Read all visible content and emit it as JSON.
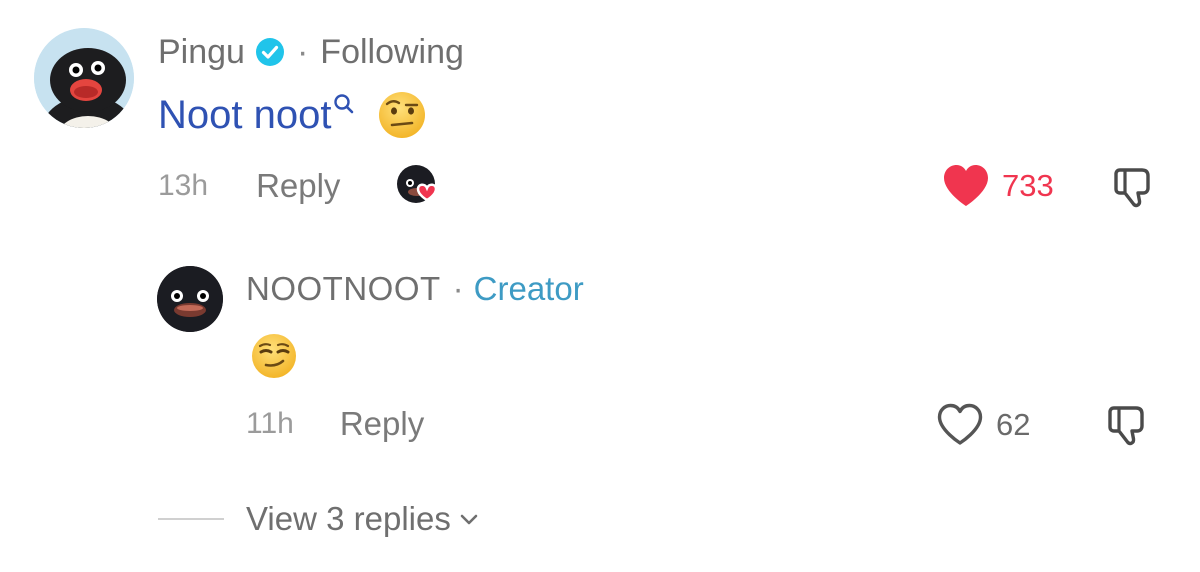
{
  "comment": {
    "author": "Pingu",
    "relation": "Following",
    "text": "Noot noot",
    "emoji": "raised-eyebrow-emoji",
    "time": "13h",
    "reply_label": "Reply",
    "likes": "733",
    "liked": true,
    "liked_by_creator": true
  },
  "reply": {
    "author": "NOOTNOOT",
    "badge": "Creator",
    "emoji": "smirking-face-emoji",
    "time": "11h",
    "reply_label": "Reply",
    "likes": "62",
    "liked": false
  },
  "view_replies": {
    "label": "View 3 replies"
  },
  "colors": {
    "like_red": "#f0354f",
    "link_blue": "#2f52b3",
    "creator_blue": "#3e9bc4",
    "verified_blue": "#20c4ea"
  }
}
